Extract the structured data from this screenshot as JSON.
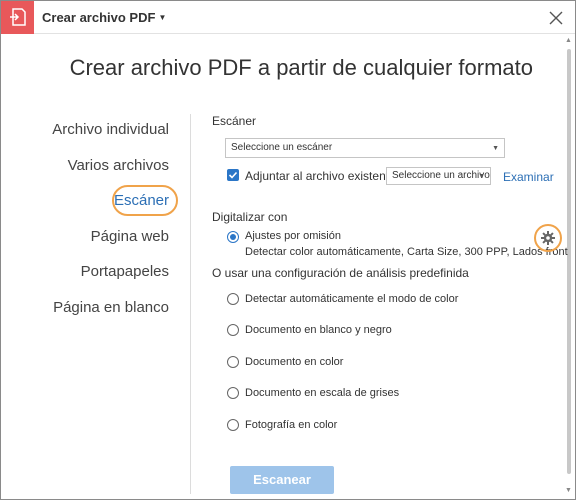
{
  "window": {
    "title": "Crear archivo PDF"
  },
  "heading": "Crear archivo PDF a partir de cualquier formato",
  "nav": {
    "items": [
      {
        "label": "Archivo individual"
      },
      {
        "label": "Varios archivos"
      },
      {
        "label": "Escáner",
        "active": true
      },
      {
        "label": "Página web"
      },
      {
        "label": "Portapapeles"
      },
      {
        "label": "Página en blanco"
      }
    ]
  },
  "scanner": {
    "section_label": "Escáner",
    "select_value": "Seleccione un escáner",
    "append_label": "Adjuntar al archivo existente",
    "append_checked": true,
    "file_select_value": "Seleccione un archivo",
    "browse_label": "Examinar"
  },
  "digitize": {
    "section_label": "Digitalizar con",
    "default_label": "Ajustes por omisión",
    "default_desc": "Detectar color automáticamente, Carta Size, 300 PPP, Lados front",
    "preset_label": "O usar una configuración de análisis predefinida",
    "presets": [
      "Detectar automáticamente el modo de color",
      "Documento en blanco y negro",
      "Documento en color",
      "Documento en escala de grises",
      "Fotografía en color"
    ]
  },
  "scan_button": "Escanear",
  "colors": {
    "accent": "#2b76c7",
    "highlight": "#f0a34a",
    "app_icon": "#e8585a",
    "scan_button": "#9ec4ea"
  }
}
